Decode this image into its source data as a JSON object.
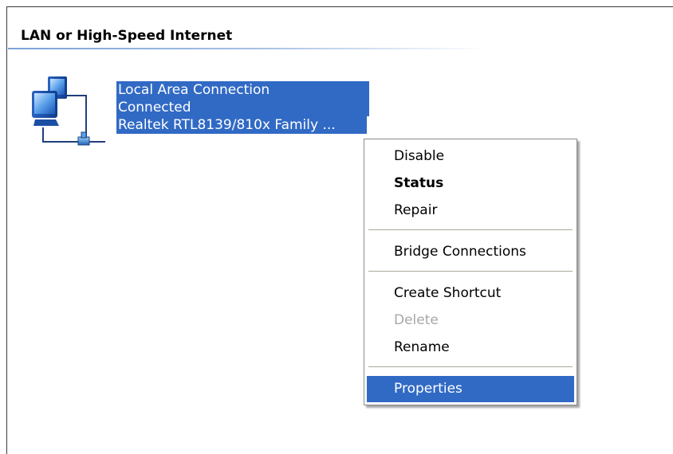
{
  "group": {
    "title": "LAN or High-Speed Internet"
  },
  "connection": {
    "name": "Local Area Connection",
    "status": "Connected",
    "device": "Realtek RTL8139/810x Family ...",
    "icon": "network-connection-icon"
  },
  "context_menu": {
    "items": [
      {
        "label": "Disable",
        "bold": false,
        "disabled": false,
        "highlighted": false
      },
      {
        "label": "Status",
        "bold": true,
        "disabled": false,
        "highlighted": false
      },
      {
        "label": "Repair",
        "bold": false,
        "disabled": false,
        "highlighted": false
      },
      {
        "label": "Bridge Connections",
        "bold": false,
        "disabled": false,
        "highlighted": false
      },
      {
        "label": "Create Shortcut",
        "bold": false,
        "disabled": false,
        "highlighted": false
      },
      {
        "label": "Delete",
        "bold": false,
        "disabled": true,
        "highlighted": false
      },
      {
        "label": "Rename",
        "bold": false,
        "disabled": false,
        "highlighted": false
      },
      {
        "label": "Properties",
        "bold": false,
        "disabled": false,
        "highlighted": true
      }
    ]
  },
  "colors": {
    "selection": "#316ac5",
    "disabled_text": "#a7a6aa",
    "separator": "#aca899"
  }
}
